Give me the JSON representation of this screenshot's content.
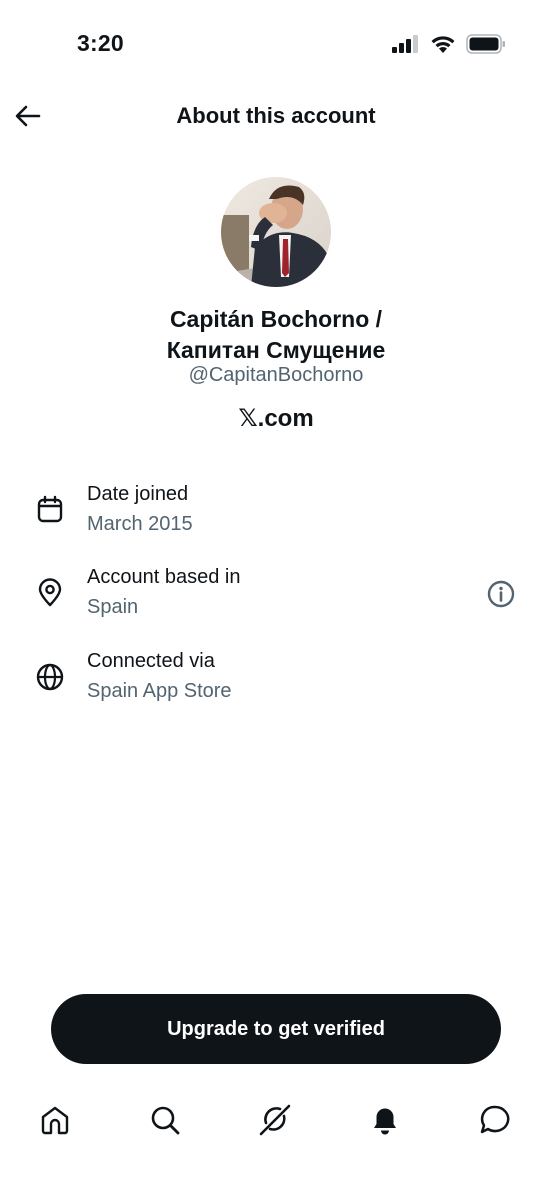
{
  "status_bar": {
    "time": "3:20",
    "icons": [
      "cellular-signal-icon",
      "wifi-icon",
      "battery-icon"
    ]
  },
  "header": {
    "back_icon": "arrow-left-icon",
    "title": "About this account"
  },
  "profile": {
    "avatar": "profile-photo",
    "display_name_line1": "Capitán Bochorno /",
    "display_name_line2": "Капитан Смущение",
    "handle": "@CapitanBochorno",
    "site": "𝕏.com"
  },
  "info": [
    {
      "icon": "calendar-icon",
      "label": "Date joined",
      "value": "March 2015"
    },
    {
      "icon": "location-pin-icon",
      "label": "Account based in",
      "value": "Spain",
      "extra_icon": "info-icon"
    },
    {
      "icon": "globe-icon",
      "label": "Connected via",
      "value": "Spain App Store"
    }
  ],
  "upgrade": {
    "label": "Upgrade to get verified"
  },
  "bottom_nav": {
    "items": [
      "home-icon",
      "search-icon",
      "grok-icon",
      "notifications-bell-icon",
      "messages-icon"
    ]
  },
  "colors": {
    "text_primary": "#0f1419",
    "text_secondary": "#536471",
    "button_bg": "#0f1419",
    "background": "#ffffff"
  }
}
